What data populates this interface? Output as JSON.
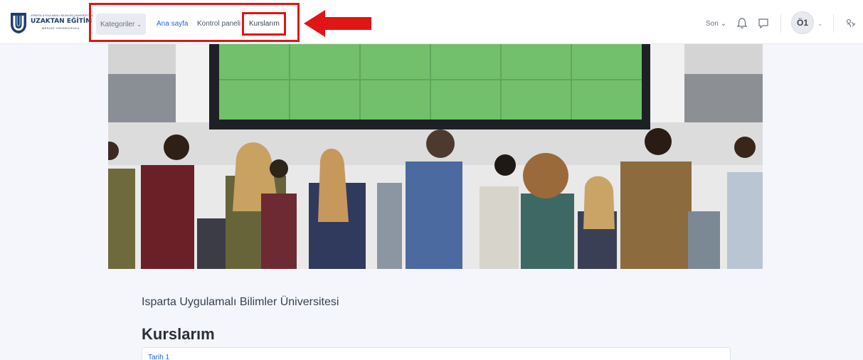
{
  "brand": {
    "logo_top_line": "ISPARTA UYGULAMALI BİLİMLER ÜNİVERSİTESİ",
    "logo_main": "UZAKTAN EĞİTİM",
    "logo_sub": "MESLEK YÜKSEKOKULU",
    "primary_color": "#1f3d6e"
  },
  "nav": {
    "categories_label": "Kategoriler",
    "links": [
      "Ana sayfa",
      "Kontrol paneli",
      "Kurslarım"
    ],
    "active_link": "Ana sayfa",
    "highlight_color": "#e01616"
  },
  "user_menu": {
    "recent_label": "Son",
    "icons": [
      "bell-icon",
      "chat-icon",
      "theme-toggle-icon"
    ],
    "avatar_initials": "Ö1"
  },
  "hero": {
    "image": "students-facing-video-wall"
  },
  "content": {
    "university_name": "Isparta Uygulamalı Bilimler Üniversitesi",
    "page_title": "Kurslarım",
    "first_course": "Tarih 1"
  }
}
